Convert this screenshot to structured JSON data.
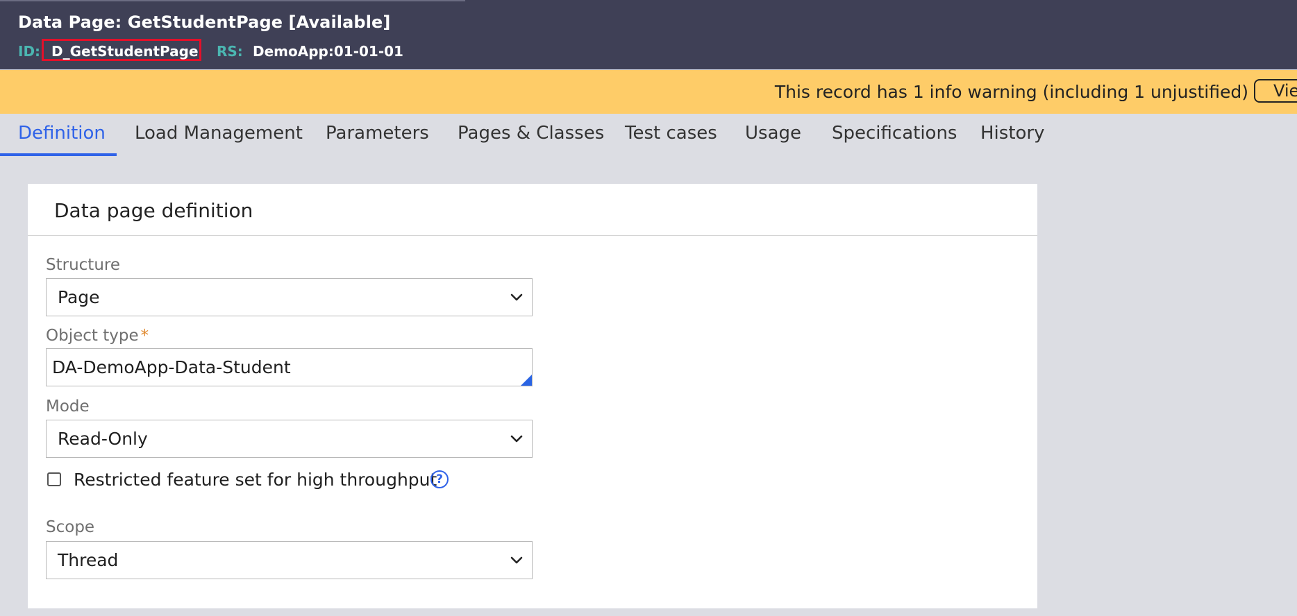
{
  "header": {
    "title": "Data Page: GetStudentPage [Available]",
    "id_label": "ID:",
    "id_value": "D_GetStudentPage",
    "rs_label": "RS:",
    "rs_value": "DemoApp:01-01-01"
  },
  "warning": {
    "text": "This record has 1 info warning (including 1 unjustified)",
    "button_label": "View"
  },
  "tabs": [
    {
      "label": "Definition",
      "active": true
    },
    {
      "label": "Load Management"
    },
    {
      "label": "Parameters"
    },
    {
      "label": "Pages & Classes"
    },
    {
      "label": "Test cases"
    },
    {
      "label": "Usage"
    },
    {
      "label": "Specifications"
    },
    {
      "label": "History"
    }
  ],
  "card": {
    "title": "Data page definition",
    "structure": {
      "label": "Structure",
      "value": "Page"
    },
    "object_type": {
      "label": "Object type",
      "required_mark": "*",
      "value": "DA-DemoApp-Data-Student"
    },
    "mode": {
      "label": "Mode",
      "value": "Read-Only"
    },
    "restricted": {
      "label": "Restricted feature set for high throughput",
      "checked": false,
      "help_icon": "?"
    },
    "scope": {
      "label": "Scope",
      "value": "Thread"
    }
  },
  "colors": {
    "header_bg": "#3f4056",
    "warning_bg": "#fecc68",
    "accent": "#2f62e8",
    "id_highlight": "#e3102a",
    "label_teal": "#4bb6b1"
  }
}
